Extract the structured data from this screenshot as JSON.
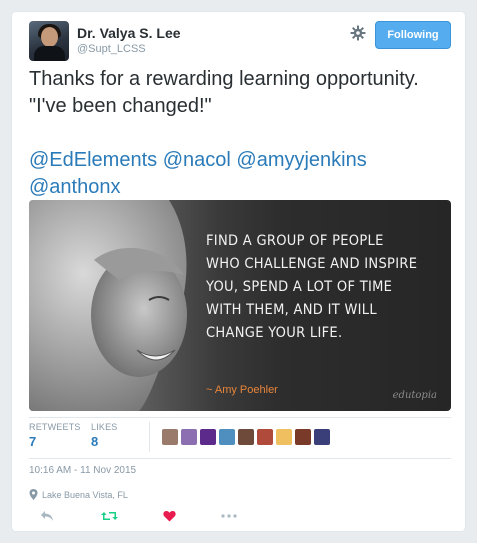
{
  "author": {
    "name": "Dr. Valya S. Lee",
    "handle": "@Supt_LCSS"
  },
  "header": {
    "follow_label": "Following",
    "settings_icon": "gear-icon"
  },
  "tweet": {
    "text_lines": [
      "Thanks for a rewarding learning opportunity.",
      "\"I've been changed!\""
    ],
    "mentions": [
      "@EdElements",
      "@nacol",
      "@amyyjenkins",
      "@anthonx"
    ]
  },
  "image": {
    "quote_lines": [
      "Find a group of people",
      "who challenge and inspire",
      "you, spend a lot of time",
      "with them, and it will",
      "change your life."
    ],
    "author": "~ Amy Poehler",
    "brand": "edutopia"
  },
  "stats": {
    "retweets_label": "RETWEETS",
    "retweets_value": "7",
    "likes_label": "LIKES",
    "likes_value": "8"
  },
  "likers": [
    {
      "color": "#9a7a6a"
    },
    {
      "color": "#8b6fb0"
    },
    {
      "color": "#5b2a8a"
    },
    {
      "color": "#4f8fbf"
    },
    {
      "color": "#6e4a3a"
    },
    {
      "color": "#b04a3a"
    },
    {
      "color": "#f0c060"
    },
    {
      "color": "#7a3a2a"
    },
    {
      "color": "#3a3f7a"
    }
  ],
  "meta": {
    "timestamp": "10:16 AM - 11 Nov 2015",
    "location": "Lake Buena Vista, FL"
  },
  "colors": {
    "link": "#2b7bb9",
    "retweet_green": "#19cf86",
    "like_red": "#e81c4f",
    "follow_blue": "#55acee"
  }
}
